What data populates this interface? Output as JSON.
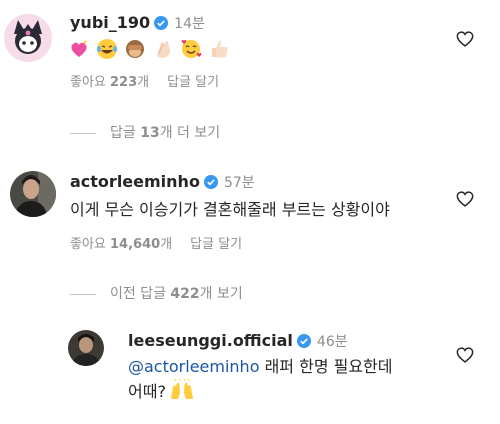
{
  "comments": [
    {
      "username": "yubi_190",
      "time": "14분",
      "likes_prefix": "좋아요 ",
      "likes_count": "223",
      "likes_suffix": "개",
      "reply_label": "답글 달기",
      "emojis": [
        "sparkling-heart",
        "tears-of-joy",
        "see-no-evil-monkey",
        "clapping-hands",
        "smiling-face-with-hearts",
        "thumbs-up"
      ]
    },
    {
      "username": "actorleeminho",
      "time": "57분",
      "text": "이게 무슨 이승기가 결혼해줄래 부르는 상황이야",
      "likes_prefix": "좋아요 ",
      "likes_count": "14,640",
      "likes_suffix": "개",
      "reply_label": "답글 달기"
    },
    {
      "username": "leeseunggi.official",
      "time": "46분",
      "mention": "@actorleeminho",
      "text_rest": " 래퍼 한명 필요한데",
      "text_line2": "어때?"
    }
  ],
  "threads": [
    {
      "prefix": "답글 ",
      "count": "13",
      "suffix": "개 더 보기"
    },
    {
      "prefix": "이전 답글 ",
      "count": "422",
      "suffix": "개 보기"
    }
  ],
  "colors": {
    "verified": "#3897f0",
    "muted": "#8e8e8e",
    "mention": "#1a56a6"
  }
}
